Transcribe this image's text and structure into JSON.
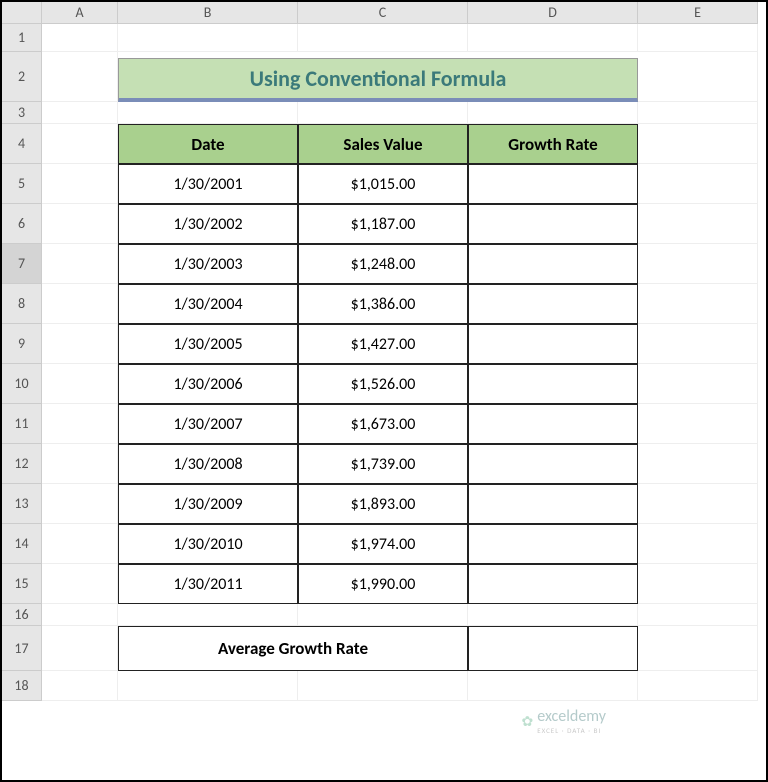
{
  "columns": [
    "A",
    "B",
    "C",
    "D",
    "E"
  ],
  "row_numbers": [
    "1",
    "2",
    "3",
    "4",
    "5",
    "6",
    "7",
    "8",
    "9",
    "10",
    "11",
    "12",
    "13",
    "14",
    "15",
    "16",
    "17",
    "18"
  ],
  "selected_row": "7",
  "title": "Using Conventional Formula",
  "headers": {
    "date": "Date",
    "sales": "Sales Value",
    "growth": "Growth Rate"
  },
  "rows": [
    {
      "date": "1/30/2001",
      "sales": "$1,015.00",
      "growth": ""
    },
    {
      "date": "1/30/2002",
      "sales": "$1,187.00",
      "growth": ""
    },
    {
      "date": "1/30/2003",
      "sales": "$1,248.00",
      "growth": ""
    },
    {
      "date": "1/30/2004",
      "sales": "$1,386.00",
      "growth": ""
    },
    {
      "date": "1/30/2005",
      "sales": "$1,427.00",
      "growth": ""
    },
    {
      "date": "1/30/2006",
      "sales": "$1,526.00",
      "growth": ""
    },
    {
      "date": "1/30/2007",
      "sales": "$1,673.00",
      "growth": ""
    },
    {
      "date": "1/30/2008",
      "sales": "$1,739.00",
      "growth": ""
    },
    {
      "date": "1/30/2009",
      "sales": "$1,893.00",
      "growth": ""
    },
    {
      "date": "1/30/2010",
      "sales": "$1,974.00",
      "growth": ""
    },
    {
      "date": "1/30/2011",
      "sales": "$1,990.00",
      "growth": ""
    }
  ],
  "avg_label": "Average Growth Rate",
  "avg_value": "",
  "watermark": {
    "brand": "exceldemy",
    "tag": "EXCEL · DATA · BI"
  },
  "chart_data": {
    "type": "table",
    "title": "Using Conventional Formula",
    "columns": [
      "Date",
      "Sales Value",
      "Growth Rate"
    ],
    "data": [
      [
        "1/30/2001",
        1015.0,
        null
      ],
      [
        "1/30/2002",
        1187.0,
        null
      ],
      [
        "1/30/2003",
        1248.0,
        null
      ],
      [
        "1/30/2004",
        1386.0,
        null
      ],
      [
        "1/30/2005",
        1427.0,
        null
      ],
      [
        "1/30/2006",
        1526.0,
        null
      ],
      [
        "1/30/2007",
        1673.0,
        null
      ],
      [
        "1/30/2008",
        1739.0,
        null
      ],
      [
        "1/30/2009",
        1893.0,
        null
      ],
      [
        "1/30/2010",
        1974.0,
        null
      ],
      [
        "1/30/2011",
        1990.0,
        null
      ]
    ]
  }
}
